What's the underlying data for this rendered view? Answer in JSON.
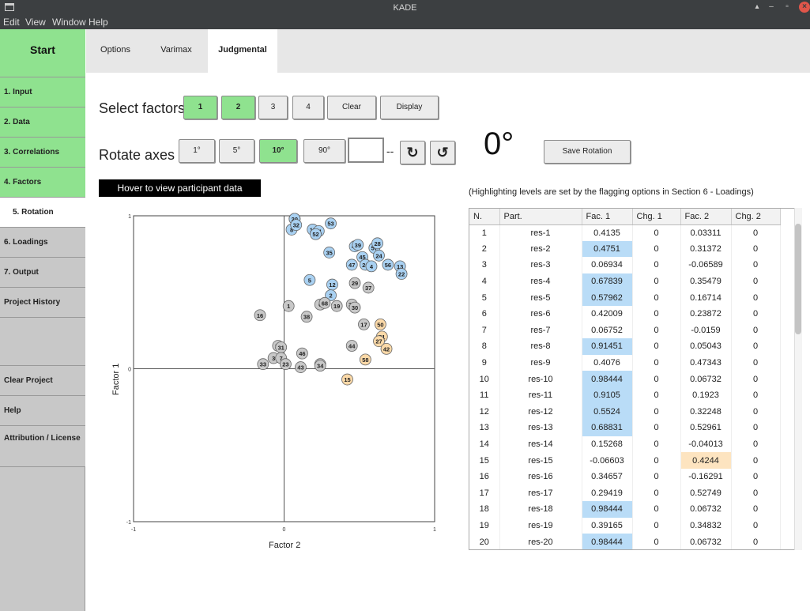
{
  "window": {
    "title": "KADE"
  },
  "menu": [
    "Edit",
    "View",
    "Window",
    "Help"
  ],
  "sidebar": {
    "start": "Start",
    "items": [
      "1. Input",
      "2. Data",
      "3. Correlations",
      "4. Factors",
      "5. Rotation",
      "6. Loadings",
      "7. Output",
      "Project History"
    ],
    "bottom": [
      "Clear Project",
      "Help",
      "Attribution / License"
    ]
  },
  "tabs": [
    "Options",
    "Varimax",
    "Judgmental"
  ],
  "select_factors": {
    "label": "Select factors:",
    "buttons": [
      "1",
      "2",
      "3",
      "4",
      "Clear",
      "Display"
    ]
  },
  "rotate": {
    "label": "Rotate axes",
    "buttons": [
      "1°",
      "5°",
      "10°",
      "90°"
    ],
    "dashes": "--",
    "cw_icon": "↻",
    "ccw_icon": "↺"
  },
  "degree": "0°",
  "save_rotation": "Save Rotation",
  "hover_text": "Hover to view participant data",
  "highlight_note": "(Highlighting levels are set by the flagging options in Section 6 - Loadings)",
  "table": {
    "headers": [
      "N.",
      "Part.",
      "Fac. 1",
      "Chg. 1",
      "Fac. 2",
      "Chg. 2"
    ],
    "rows": [
      [
        "1",
        "res-1",
        "0.4135",
        "0",
        "0.03311",
        "0"
      ],
      [
        "2",
        "res-2",
        "0.4751",
        "0",
        "0.31372",
        "0"
      ],
      [
        "3",
        "res-3",
        "0.06934",
        "0",
        "-0.06589",
        "0"
      ],
      [
        "4",
        "res-4",
        "0.67839",
        "0",
        "0.35479",
        "0"
      ],
      [
        "5",
        "res-5",
        "0.57962",
        "0",
        "0.16714",
        "0"
      ],
      [
        "6",
        "res-6",
        "0.42009",
        "0",
        "0.23872",
        "0"
      ],
      [
        "7",
        "res-7",
        "0.06752",
        "0",
        "-0.0159",
        "0"
      ],
      [
        "8",
        "res-8",
        "0.91451",
        "0",
        "0.05043",
        "0"
      ],
      [
        "9",
        "res-9",
        "0.4076",
        "0",
        "0.47343",
        "0"
      ],
      [
        "10",
        "res-10",
        "0.98444",
        "0",
        "0.06732",
        "0"
      ],
      [
        "11",
        "res-11",
        "0.9105",
        "0",
        "0.1923",
        "0"
      ],
      [
        "12",
        "res-12",
        "0.5524",
        "0",
        "0.32248",
        "0"
      ],
      [
        "13",
        "res-13",
        "0.68831",
        "0",
        "0.52961",
        "0"
      ],
      [
        "14",
        "res-14",
        "0.15268",
        "0",
        "-0.04013",
        "0"
      ],
      [
        "15",
        "res-15",
        "-0.06603",
        "0",
        "0.4244",
        "0"
      ],
      [
        "16",
        "res-16",
        "0.34657",
        "0",
        "-0.16291",
        "0"
      ],
      [
        "17",
        "res-17",
        "0.29419",
        "0",
        "0.52749",
        "0"
      ],
      [
        "18",
        "res-18",
        "0.98444",
        "0",
        "0.06732",
        "0"
      ],
      [
        "19",
        "res-19",
        "0.39165",
        "0",
        "0.34832",
        "0"
      ],
      [
        "20",
        "res-20",
        "0.98444",
        "0",
        "0.06732",
        "0"
      ]
    ],
    "highlight_fac1": [
      "2",
      "4",
      "5",
      "8",
      "10",
      "11",
      "12",
      "13",
      "18",
      "20"
    ],
    "highlight_fac2": [
      "15"
    ]
  },
  "colors": {
    "green": "#8fe28f",
    "blue_hl": "#b9dcf7",
    "orange_hl": "#fde4c0"
  },
  "chart_data": {
    "type": "scatter",
    "xlabel": "Factor 2",
    "ylabel": "Factor 1",
    "xlim": [
      -1,
      1
    ],
    "ylim": [
      -1,
      1
    ],
    "x_ticks": [
      "-1",
      "0",
      "1"
    ],
    "y_ticks": [
      "1",
      "0",
      "-1"
    ],
    "points": [
      {
        "label": "10",
        "x": 0.07,
        "y": 0.98,
        "group": "blue"
      },
      {
        "label": "18",
        "x": 0.07,
        "y": 0.98,
        "group": "blue"
      },
      {
        "label": "20",
        "x": 0.07,
        "y": 0.98,
        "group": "blue"
      },
      {
        "label": "8",
        "x": 0.05,
        "y": 0.91,
        "group": "blue"
      },
      {
        "label": "32",
        "x": 0.08,
        "y": 0.94,
        "group": "blue"
      },
      {
        "label": "53",
        "x": 0.31,
        "y": 0.95,
        "group": "blue"
      },
      {
        "label": "11",
        "x": 0.19,
        "y": 0.91,
        "group": "blue"
      },
      {
        "label": "41",
        "x": 0.23,
        "y": 0.9,
        "group": "blue"
      },
      {
        "label": "52",
        "x": 0.21,
        "y": 0.88,
        "group": "blue"
      },
      {
        "label": "35",
        "x": 0.3,
        "y": 0.76,
        "group": "blue"
      },
      {
        "label": "49",
        "x": 0.47,
        "y": 0.8,
        "group": "blue"
      },
      {
        "label": "39",
        "x": 0.49,
        "y": 0.81,
        "group": "blue"
      },
      {
        "label": "57",
        "x": 0.6,
        "y": 0.79,
        "group": "blue"
      },
      {
        "label": "28",
        "x": 0.62,
        "y": 0.82,
        "group": "blue"
      },
      {
        "label": "24",
        "x": 0.63,
        "y": 0.74,
        "group": "blue"
      },
      {
        "label": "45",
        "x": 0.52,
        "y": 0.73,
        "group": "blue"
      },
      {
        "label": "47",
        "x": 0.45,
        "y": 0.68,
        "group": "blue"
      },
      {
        "label": "26",
        "x": 0.54,
        "y": 0.68,
        "group": "blue"
      },
      {
        "label": "4",
        "x": 0.58,
        "y": 0.67,
        "group": "blue"
      },
      {
        "label": "56",
        "x": 0.69,
        "y": 0.68,
        "group": "blue"
      },
      {
        "label": "13",
        "x": 0.77,
        "y": 0.67,
        "group": "blue"
      },
      {
        "label": "22",
        "x": 0.78,
        "y": 0.62,
        "group": "blue"
      },
      {
        "label": "5",
        "x": 0.17,
        "y": 0.58,
        "group": "blue"
      },
      {
        "label": "12",
        "x": 0.32,
        "y": 0.55,
        "group": "blue"
      },
      {
        "label": "2",
        "x": 0.31,
        "y": 0.48,
        "group": "blue"
      },
      {
        "label": "29",
        "x": 0.47,
        "y": 0.56,
        "group": "gray"
      },
      {
        "label": "37",
        "x": 0.56,
        "y": 0.53,
        "group": "gray"
      },
      {
        "label": "6",
        "x": 0.24,
        "y": 0.42,
        "group": "gray"
      },
      {
        "label": "68",
        "x": 0.27,
        "y": 0.43,
        "group": "gray"
      },
      {
        "label": "19",
        "x": 0.35,
        "y": 0.41,
        "group": "gray"
      },
      {
        "label": "36",
        "x": 0.45,
        "y": 0.42,
        "group": "gray"
      },
      {
        "label": "30",
        "x": 0.47,
        "y": 0.4,
        "group": "gray"
      },
      {
        "label": "1",
        "x": 0.03,
        "y": 0.41,
        "group": "gray"
      },
      {
        "label": "38",
        "x": 0.15,
        "y": 0.34,
        "group": "gray"
      },
      {
        "label": "16",
        "x": -0.16,
        "y": 0.35,
        "group": "gray"
      },
      {
        "label": "17",
        "x": 0.53,
        "y": 0.29,
        "group": "gray"
      },
      {
        "label": "50",
        "x": 0.64,
        "y": 0.29,
        "group": "orange"
      },
      {
        "label": "51",
        "x": 0.65,
        "y": 0.21,
        "group": "orange"
      },
      {
        "label": "27",
        "x": 0.63,
        "y": 0.18,
        "group": "orange"
      },
      {
        "label": "42",
        "x": 0.68,
        "y": 0.13,
        "group": "orange"
      },
      {
        "label": "44",
        "x": 0.45,
        "y": 0.15,
        "group": "gray"
      },
      {
        "label": "58",
        "x": 0.54,
        "y": 0.06,
        "group": "orange"
      },
      {
        "label": "15",
        "x": 0.42,
        "y": -0.07,
        "group": "orange"
      },
      {
        "label": "14",
        "x": -0.04,
        "y": 0.15,
        "group": "gray"
      },
      {
        "label": "31",
        "x": -0.02,
        "y": 0.14,
        "group": "gray"
      },
      {
        "label": "46",
        "x": 0.12,
        "y": 0.1,
        "group": "gray"
      },
      {
        "label": "3",
        "x": -0.07,
        "y": 0.07,
        "group": "gray"
      },
      {
        "label": "7",
        "x": -0.02,
        "y": 0.07,
        "group": "gray"
      },
      {
        "label": "33",
        "x": -0.14,
        "y": 0.03,
        "group": "gray"
      },
      {
        "label": "23",
        "x": 0.01,
        "y": 0.03,
        "group": "gray"
      },
      {
        "label": "43",
        "x": 0.11,
        "y": 0.01,
        "group": "gray"
      },
      {
        "label": "55",
        "x": 0.24,
        "y": 0.03,
        "group": "gray"
      },
      {
        "label": "34",
        "x": 0.24,
        "y": 0.02,
        "group": "gray"
      }
    ],
    "group_colors": {
      "blue": "#a9d1f2",
      "gray": "#c8c8c8",
      "orange": "#fbd9a8"
    }
  }
}
